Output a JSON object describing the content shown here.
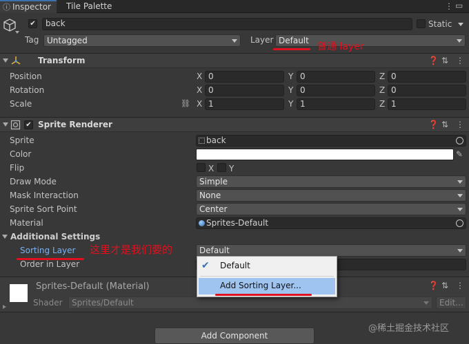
{
  "tabs": {
    "inspector": "Inspector",
    "tile_palette": "Tile Palette"
  },
  "header": {
    "object_name": "back",
    "static_label": "Static",
    "tag_label": "Tag",
    "tag_value": "Untagged",
    "layer_label": "Layer",
    "layer_value": "Default"
  },
  "transform": {
    "title": "Transform",
    "rows": [
      {
        "label": "Position",
        "x": "0",
        "y": "0",
        "z": "0"
      },
      {
        "label": "Rotation",
        "x": "0",
        "y": "0",
        "z": "0"
      },
      {
        "label": "Scale",
        "x": "1",
        "y": "1",
        "z": "1"
      }
    ],
    "axis_x": "X",
    "axis_y": "Y",
    "axis_z": "Z"
  },
  "sprite_renderer": {
    "title": "Sprite Renderer",
    "sprite_label": "Sprite",
    "sprite_value": "back",
    "color_label": "Color",
    "color_value": "#ffffff",
    "flip_label": "Flip",
    "flip_x": "X",
    "flip_y": "Y",
    "draw_mode_label": "Draw Mode",
    "draw_mode_value": "Simple",
    "mask_label": "Mask Interaction",
    "mask_value": "None",
    "sort_point_label": "Sprite Sort Point",
    "sort_point_value": "Center",
    "material_label": "Material",
    "material_value": "Sprites-Default",
    "additional_label": "Additional Settings",
    "sorting_layer_label": "Sorting Layer",
    "sorting_layer_value": "Default",
    "order_label": "Order in Layer"
  },
  "popup": {
    "option_default": "Default",
    "option_add": "Add Sorting Layer..."
  },
  "material_section": {
    "title": "Sprites-Default (Material)",
    "shader_label": "Shader",
    "shader_value": "Sprites/Default",
    "edit_label": "Edit..."
  },
  "add_component": "Add Component",
  "annotations": {
    "layer_note": "普通 layer",
    "sorting_note": "这里才是我们要的"
  },
  "watermark": "@稀土掘金技术社区",
  "colors": {
    "accent": "#3a72b0",
    "annotation": "#e0101e",
    "highlight": "#9ec4ef"
  }
}
